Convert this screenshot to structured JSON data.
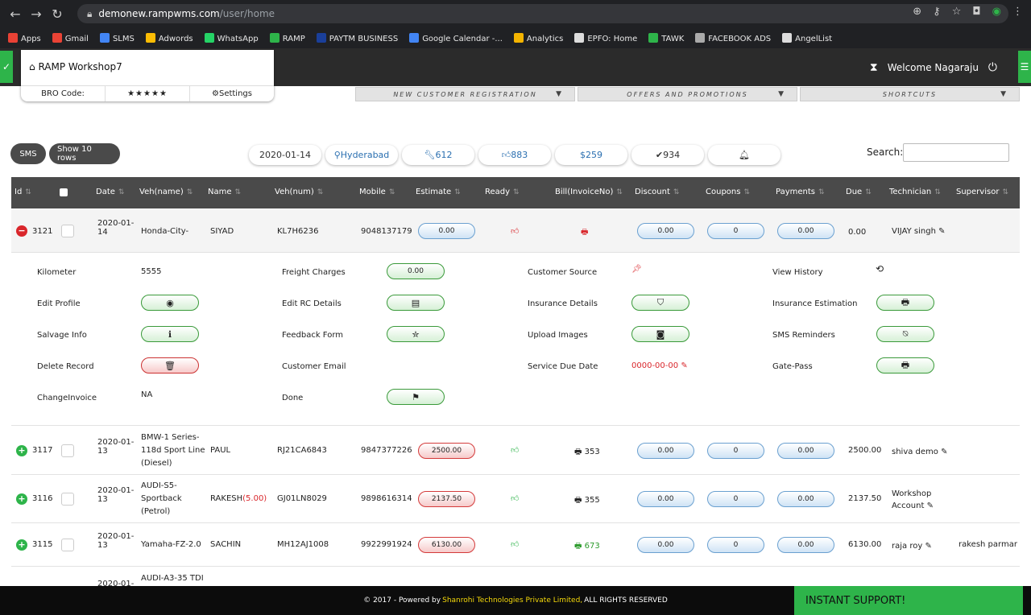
{
  "browser": {
    "host": "demonew.rampwms.com",
    "path": "/user/home"
  },
  "bookmarks": [
    {
      "label": "Apps",
      "color": "#e94235"
    },
    {
      "label": "Gmail",
      "color": "#ea4335"
    },
    {
      "label": "SLMS",
      "color": "#4285f4"
    },
    {
      "label": "Adwords",
      "color": "#fbbc04"
    },
    {
      "label": "WhatsApp",
      "color": "#25d366"
    },
    {
      "label": "RAMP",
      "color": "#2eb44a"
    },
    {
      "label": "PAYTM BUSINESS",
      "color": "#1a3f9a"
    },
    {
      "label": "Google Calendar -...",
      "color": "#4285f4"
    },
    {
      "label": "Analytics",
      "color": "#f4b400"
    },
    {
      "label": "EPFO: Home",
      "color": "#ddd"
    },
    {
      "label": "TAWK",
      "color": "#2eb44a"
    },
    {
      "label": "FACEBOOK ADS",
      "color": "#aaa"
    },
    {
      "label": "AngelList",
      "color": "#ddd"
    }
  ],
  "app": {
    "workshop": "RAMP Workshop7",
    "bro_code": "BRO Code:",
    "stars": "★★★★★",
    "settings": "Settings",
    "welcome": "Welcome  Nagaraju"
  },
  "menus": {
    "reg": "NEW CUSTOMER REGISTRATION",
    "offers": "OFFERS AND PROMOTIONS",
    "shortcuts": "SHORTCUTS"
  },
  "toolbar": {
    "sms": "SMS",
    "show_rows": "Show 10 rows",
    "search_label": "Search:"
  },
  "stats": {
    "date": "2020-01-14",
    "city": "Hyderabad",
    "tools": "612",
    "likes": "883",
    "money": "259",
    "checks": "934"
  },
  "columns": [
    "Id",
    "Date",
    "Veh(name)",
    "Name",
    "Veh(num)",
    "Mobile",
    "Estimate",
    "Ready",
    "Bill(InvoiceNo)",
    "Discount",
    "Coupons",
    "Payments",
    "Due",
    "Technician",
    "Supervisor"
  ],
  "row_3121": {
    "id": "3121",
    "date1": "2020-01-",
    "date2": "14",
    "veh": "Honda-City-",
    "name": "SIYAD",
    "num": "KL7H6236",
    "mobile": "9048137179",
    "estimate": "0.00",
    "discount": "0.00",
    "coupons": "0",
    "payments": "0.00",
    "due": "0.00",
    "tech": "VIJAY singh"
  },
  "details": {
    "kilometer": "Kilometer",
    "km_value": "5555",
    "freight": "Freight Charges",
    "freight_value": "0.00",
    "cust_source": "Customer Source",
    "view_history": "View History",
    "edit_profile": "Edit Profile",
    "edit_rc": "Edit RC Details",
    "insurance": "Insurance Details",
    "ins_est": "Insurance Estimation",
    "salvage": "Salvage Info",
    "feedback": "Feedback Form",
    "upload": "Upload Images",
    "sms_rem": "SMS Reminders",
    "delete": "Delete Record",
    "cust_email": "Customer Email",
    "service_due": "Service Due Date",
    "service_due_value": "0000-00-00",
    "gatepass": "Gate-Pass",
    "change_inv": "ChangeInvoice",
    "change_inv_value": "NA",
    "done": "Done"
  },
  "rows": [
    {
      "id": "3117",
      "date1": "2020-01-",
      "date2": "13",
      "veh1": "BMW-1 Series-",
      "veh2": "118d Sport Line",
      "veh3": "(Diesel)",
      "name": "PAUL",
      "num": "RJ21CA6843",
      "mobile": "9847377226",
      "estimate": "2500.00",
      "bill": "353",
      "discount": "0.00",
      "coupons": "0",
      "payments": "0.00",
      "due": "2500.00",
      "tech": "shiva demo",
      "tech2": "",
      "sup": ""
    },
    {
      "id": "3116",
      "date1": "2020-01-",
      "date2": "13",
      "veh1": "AUDI-S5-",
      "veh2": "Sportback",
      "veh3": "(Petrol)",
      "name": "RAKESH",
      "name_extra": "(5.00)",
      "num": "GJ01LN8029",
      "mobile": "9898616314",
      "estimate": "2137.50",
      "bill": "355",
      "discount": "0.00",
      "coupons": "0",
      "payments": "0.00",
      "due": "2137.50",
      "tech": "Workshop",
      "tech2": "Account",
      "sup": ""
    },
    {
      "id": "3115",
      "date1": "2020-01-",
      "date2": "13",
      "veh1": "Yamaha-FZ-2.0",
      "veh2": "",
      "veh3": "",
      "name": "SACHIN",
      "num": "MH12AJ1008",
      "mobile": "9922991924",
      "estimate": "6130.00",
      "bill": "673",
      "discount": "0.00",
      "coupons": "0",
      "payments": "0.00",
      "due": "6130.00",
      "tech": "raja roy",
      "tech2": "",
      "sup": "rakesh parmar"
    }
  ],
  "partial_row": {
    "date": "2020-01-",
    "veh": "AUDI-A3-35 TDI"
  },
  "footer": {
    "pre": "© 2017 - Powered by",
    "company": "Shanrohi Technologies Private Limited,",
    "post": "ALL RIGHTS RESERVED",
    "support": "INSTANT SUPPORT!"
  }
}
